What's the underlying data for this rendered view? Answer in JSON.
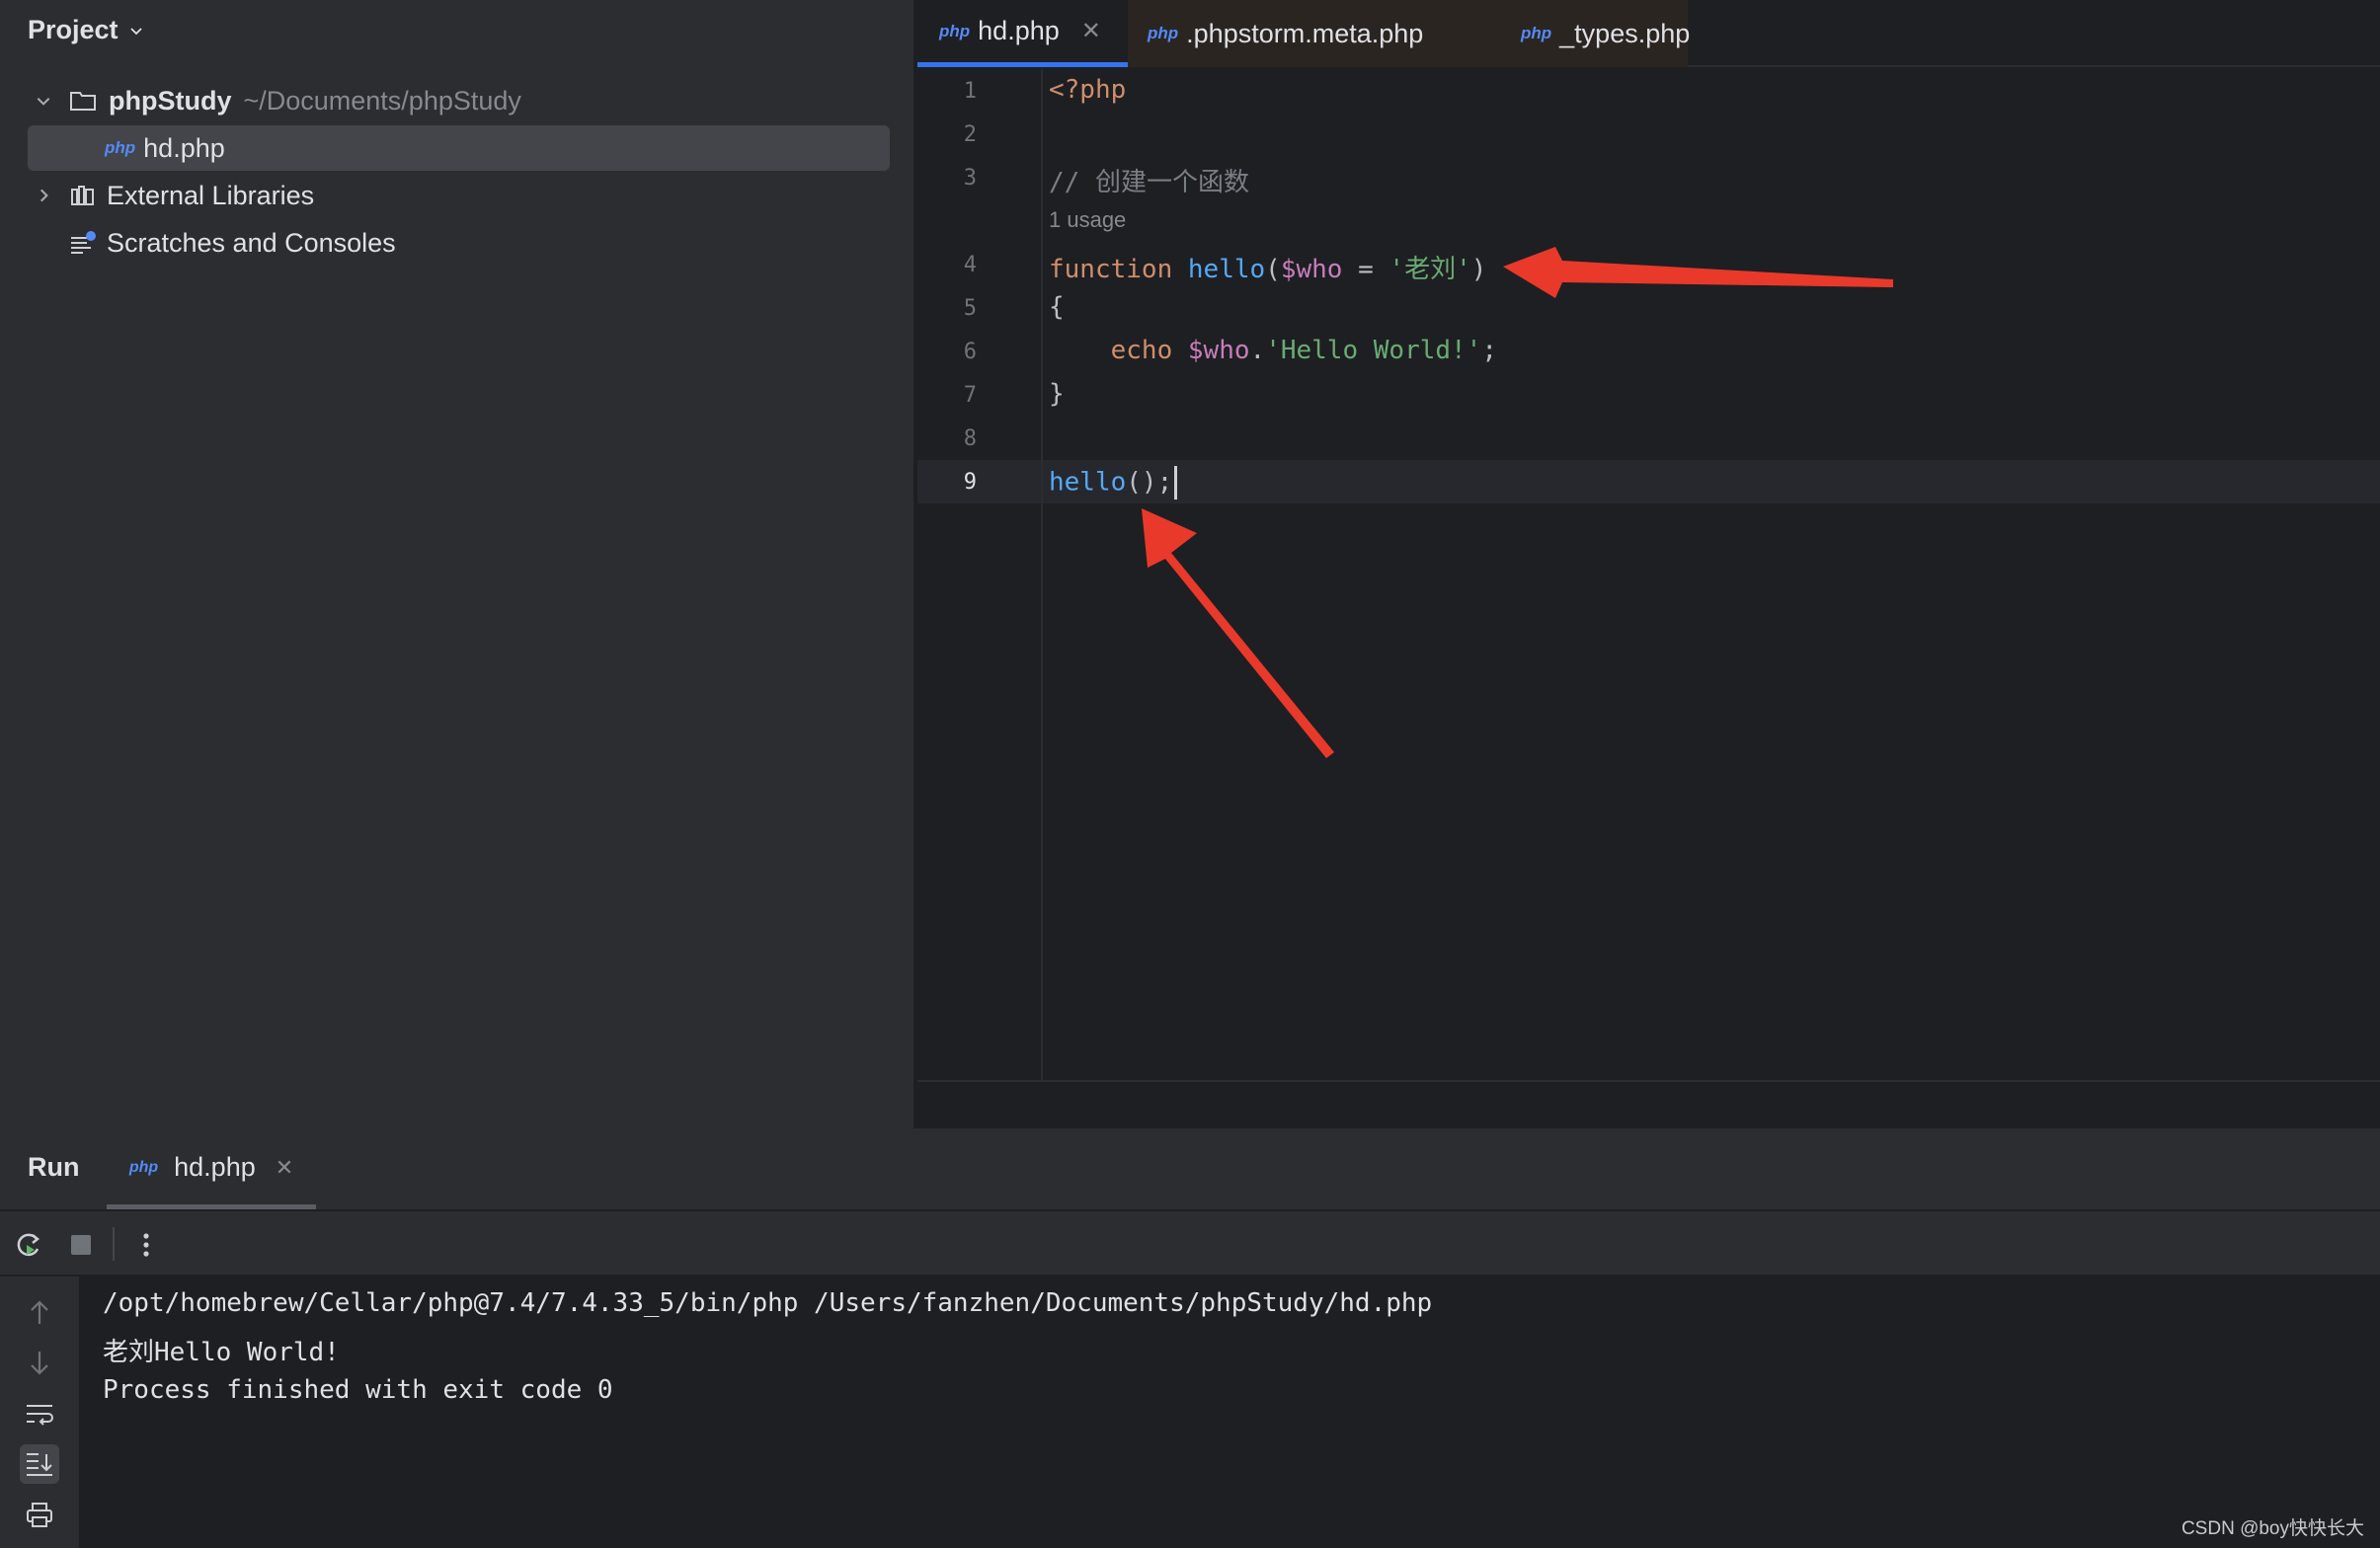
{
  "project": {
    "title": "Project",
    "root_name": "phpStudy",
    "root_path": "~/Documents/phpStudy",
    "file": "hd.php",
    "external_libraries": "External Libraries",
    "scratches": "Scratches and Consoles"
  },
  "tabs": [
    {
      "badge": "php",
      "label": "hd.php",
      "active": true
    },
    {
      "badge": "php",
      "label": ".phpstorm.meta.php",
      "active": false
    },
    {
      "badge": "php",
      "label": "_types.php",
      "active": false
    }
  ],
  "editor": {
    "line_numbers": [
      "1",
      "2",
      "3",
      "4",
      "5",
      "6",
      "7",
      "8",
      "9"
    ],
    "usage_hint": "1 usage",
    "lines": {
      "l1": "<?php",
      "l3": "// 创建一个函数",
      "l4_kw": "function",
      "l4_fn": "hello",
      "l4_open": "(",
      "l4_var": "$who",
      "l4_eq": " = ",
      "l4_str": "'老刘'",
      "l4_close": ")",
      "l5": "{",
      "l6_kw": "echo",
      "l6_var": "$who",
      "l6_dot": ".",
      "l6_str": "'Hello World!'",
      "l6_semi": ";",
      "l7": "}",
      "l9_fn": "hello",
      "l9_rest": "();"
    }
  },
  "run": {
    "title": "Run",
    "tab_label": "hd.php",
    "tab_badge": "php",
    "console": [
      "/opt/homebrew/Cellar/php@7.4/7.4.33_5/bin/php /Users/fanzhen/Documents/phpStudy/hd.php",
      "老刘Hello World!",
      "Process finished with exit code 0"
    ]
  },
  "watermark": "CSDN @boy快快长大",
  "colors": {
    "accent": "#3574f0",
    "arrow": "#e8392b"
  }
}
